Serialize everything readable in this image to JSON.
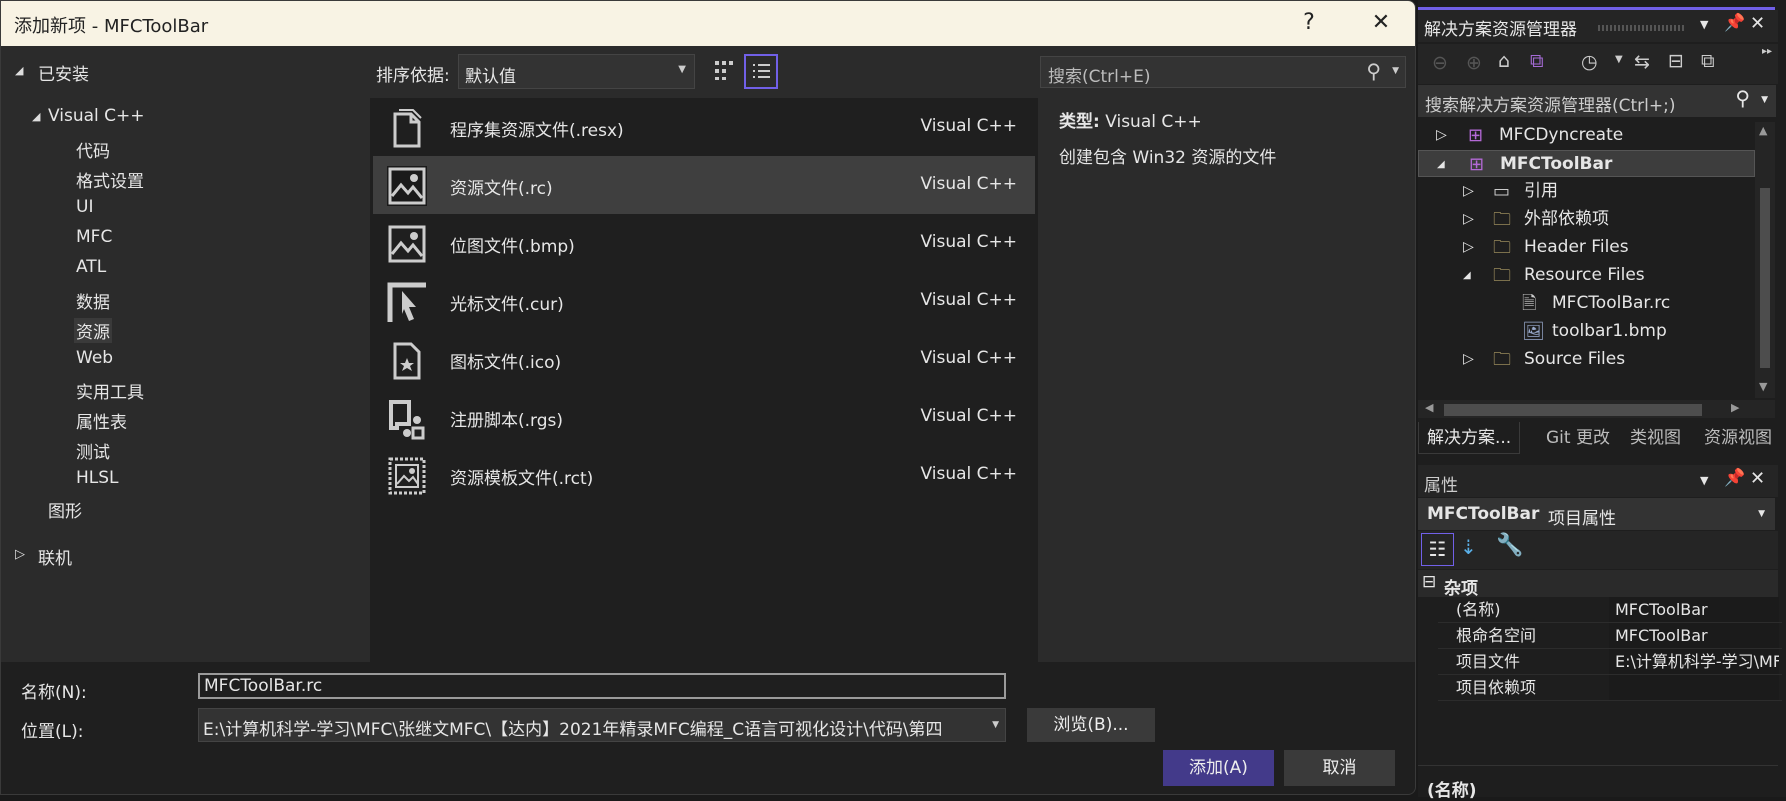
{
  "dialog": {
    "title": "添加新项 - MFCToolBar",
    "help": "?",
    "close": "✕"
  },
  "tree": {
    "installed": "已安装",
    "visual_cpp": "Visual C++",
    "children": [
      "代码",
      "格式设置",
      "UI",
      "MFC",
      "ATL",
      "数据",
      "资源",
      "Web",
      "实用工具",
      "属性表",
      "测试",
      "HLSL"
    ],
    "selected": "资源",
    "graphics": "图形",
    "online": "联机"
  },
  "toolbar": {
    "sort_label": "排序依据:",
    "sort_value": "默认值",
    "search_placeholder": "搜索(Ctrl+E)"
  },
  "templates": [
    {
      "name": "程序集资源文件(.resx)",
      "type": "Visual C++",
      "icon": "document-icon"
    },
    {
      "name": "资源文件(.rc)",
      "type": "Visual C++",
      "icon": "image-icon",
      "selected": true
    },
    {
      "name": "位图文件(.bmp)",
      "type": "Visual C++",
      "icon": "image-icon"
    },
    {
      "name": "光标文件(.cur)",
      "type": "Visual C++",
      "icon": "cursor-icon"
    },
    {
      "name": "图标文件(.ico)",
      "type": "Visual C++",
      "icon": "icon-file-icon"
    },
    {
      "name": "注册脚本(.rgs)",
      "type": "Visual C++",
      "icon": "script-icon"
    },
    {
      "name": "资源模板文件(.rct)",
      "type": "Visual C++",
      "icon": "template-icon"
    }
  ],
  "details": {
    "type_label": "类型:",
    "type_value": "Visual C++",
    "description": "创建包含 Win32 资源的文件"
  },
  "form": {
    "name_label": "名称(N):",
    "name_value": "MFCToolBar.rc",
    "location_label": "位置(L):",
    "location_value": "E:\\计算机科学-学习\\MFC\\张继文MFC\\【达内】2021年精录MFC编程_C语言可视化设计\\代码\\第四",
    "browse": "浏览(B)...",
    "add": "添加(A)",
    "cancel": "取消"
  },
  "solution_explorer": {
    "title": "解决方案资源管理器",
    "search_placeholder": "搜索解决方案资源管理器(Ctrl+;)",
    "items": [
      {
        "label": "MFCDyncreate",
        "expanded": false
      },
      {
        "label": "MFCToolBar",
        "expanded": true,
        "selected": true
      },
      {
        "label": "引用"
      },
      {
        "label": "外部依赖项"
      },
      {
        "label": "Header Files"
      },
      {
        "label": "Resource Files"
      },
      {
        "label": "MFCToolBar.rc"
      },
      {
        "label": "toolbar1.bmp"
      },
      {
        "label": "Source Files"
      }
    ],
    "tabs": [
      "解决方案...",
      "Git 更改",
      "类视图",
      "资源视图"
    ]
  },
  "properties": {
    "title": "属性",
    "object_name": "MFCToolBar",
    "object_type": "项目属性",
    "group": "杂项",
    "rows": [
      {
        "key": "(名称)",
        "value": "MFCToolBar"
      },
      {
        "key": "根命名空间",
        "value": "MFCToolBar"
      },
      {
        "key": "项目文件",
        "value": "E:\\计算机科学-学习\\MFC"
      },
      {
        "key": "项目依赖项",
        "value": ""
      }
    ],
    "description_title": "(名称)"
  },
  "colors": {
    "accent": "#7160e8",
    "primary_button": "#433a8a",
    "selection": "#3f3f3f"
  }
}
